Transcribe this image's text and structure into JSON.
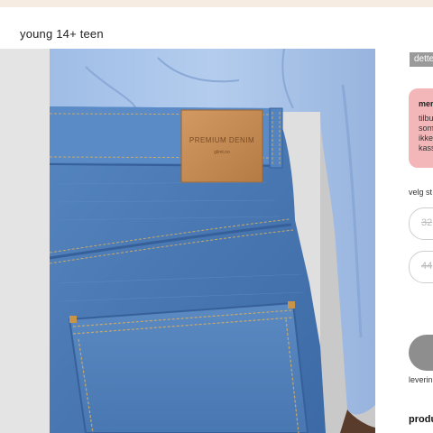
{
  "header": {
    "breadcrumb": "young 14+ teen"
  },
  "product_image": {
    "label_line1": "PREMIUM DENIM",
    "label_line2": "glimt.no"
  },
  "panel": {
    "badge": "dette",
    "notice": {
      "title": "mer",
      "lines": [
        "tilbu",
        "som",
        "ikke",
        "kass"
      ]
    },
    "size_label": "velg st",
    "sizes": [
      "32",
      "44"
    ],
    "delivery": "leverin",
    "product_heading": "produ"
  },
  "colors": {
    "top_strip": "#f6ece1",
    "notice_bg": "#f3b7b9",
    "badge_bg": "#9a9a9a",
    "button_bg": "#8e8e8e",
    "denim": "#4b7bb6",
    "shirt": "#a9c4e8",
    "leather": "#c78e57"
  }
}
